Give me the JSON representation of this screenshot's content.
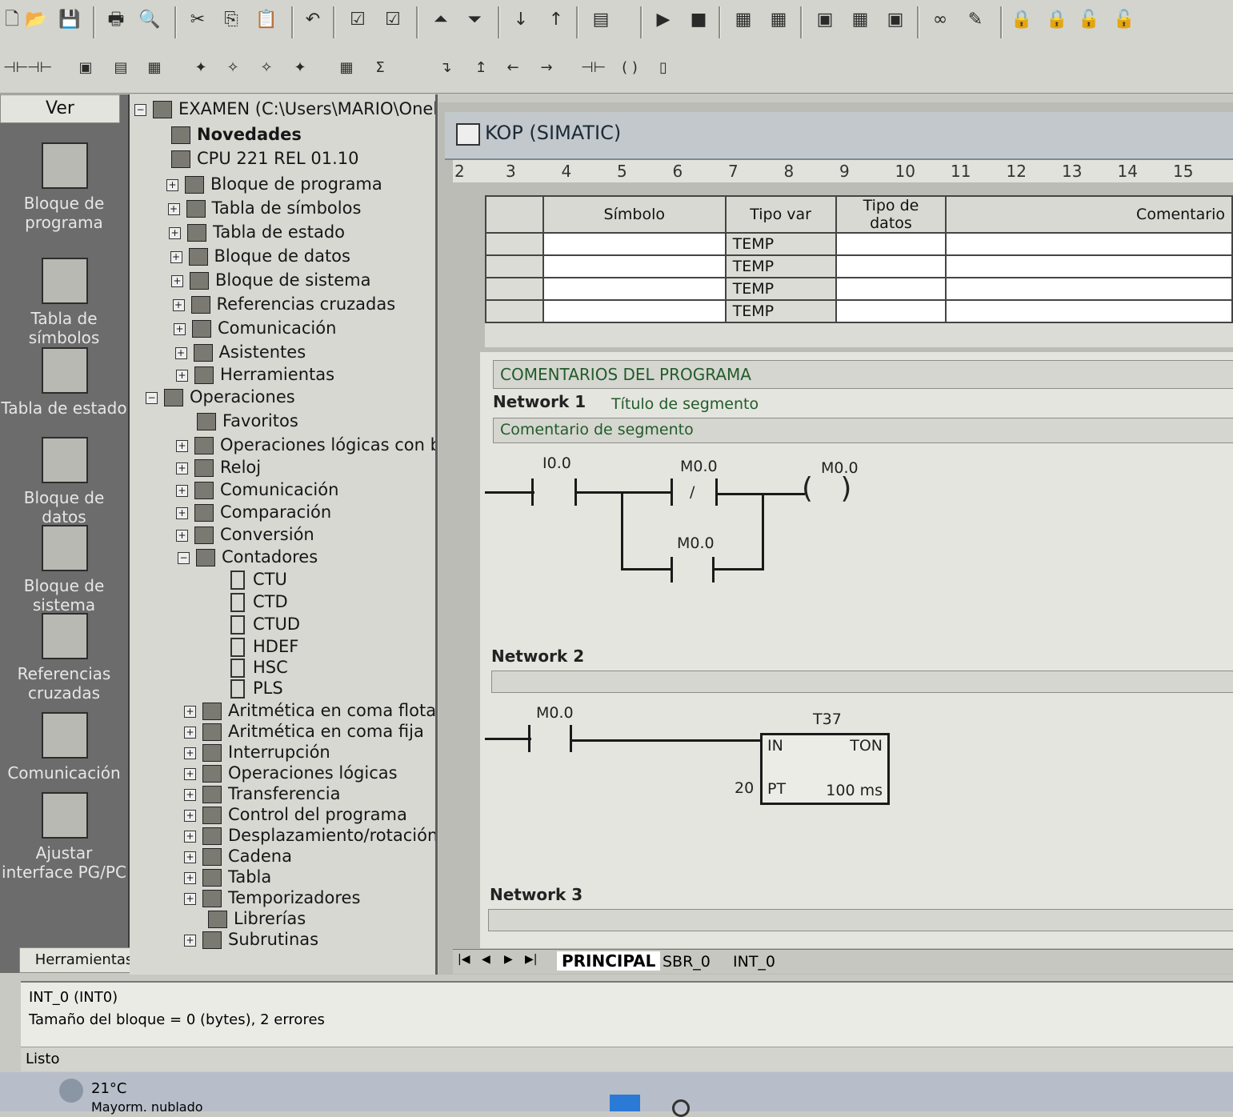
{
  "toolbar": {
    "row1_icons": [
      "new-icon",
      "open-icon",
      "save-icon",
      "print-icon",
      "print-preview-icon",
      "cut-icon",
      "copy-icon",
      "paste-icon",
      "undo-icon",
      "compile-icon",
      "compile-all-icon",
      "upload-icon",
      "download-icon",
      "sort-asc-icon",
      "sort-desc-icon",
      "options-icon",
      "run-icon",
      "stop-icon",
      "program-status-icon",
      "status-table-icon",
      "chart-icon",
      "table-icon",
      "compare-icon",
      "watch-icon",
      "eraser-icon",
      "lock-icon",
      "lock2-icon",
      "unlock-icon",
      "unlock2-icon"
    ],
    "row2_icons": [
      "contact-nav-icon",
      "coil-nav-icon",
      "view-ladder-icon",
      "view-stl-icon",
      "view-fbd-icon",
      "bookmark-icon",
      "bookmark-next-icon",
      "bookmark-prev-icon",
      "bookmark-clear-icon",
      "network-insert-icon",
      "symbol-info-icon",
      "line-down-icon",
      "line-up-icon",
      "line-left-icon",
      "line-right-icon",
      "contact-icon",
      "coil-icon",
      "box-icon"
    ]
  },
  "nav": {
    "header": "Ver",
    "items": [
      {
        "label": "Bloque de programa"
      },
      {
        "label": "Tabla de símbolos"
      },
      {
        "label": "Tabla de estado"
      },
      {
        "label": "Bloque de datos"
      },
      {
        "label": "Bloque de sistema"
      },
      {
        "label": "Referencias cruzadas"
      },
      {
        "label": "Comunicación"
      },
      {
        "label": "Ajustar interface PG/PC"
      }
    ],
    "footer": "Herramientas"
  },
  "tree": {
    "root": "EXAMEN (C:\\Users\\MARIO\\Onel",
    "novedades": "Novedades",
    "cpu": "CPU 221 REL 01.10",
    "items": [
      "Bloque de programa",
      "Tabla de símbolos",
      "Tabla de estado",
      "Bloque de datos",
      "Bloque de sistema",
      "Referencias cruzadas",
      "Comunicación",
      "Asistentes",
      "Herramientas"
    ],
    "operaciones": "Operaciones",
    "ops": [
      "Favoritos",
      "Operaciones lógicas con bits",
      "Reloj",
      "Comunicación",
      "Comparación",
      "Conversión"
    ],
    "contadores": "Contadores",
    "counters": [
      "CTU",
      "CTD",
      "CTUD",
      "HDEF",
      "HSC",
      "PLS"
    ],
    "ops2": [
      "Aritmética en coma flotante",
      "Aritmética en coma fija",
      "Interrupción",
      "Operaciones lógicas",
      "Transferencia",
      "Control del programa",
      "Desplazamiento/rotación",
      "Cadena",
      "Tabla",
      "Temporizadores",
      "Librerías",
      "Subrutinas"
    ]
  },
  "editor": {
    "title": "KOP (SIMATIC)",
    "ruler": [
      "2",
      "3",
      "4",
      "5",
      "6",
      "7",
      "8",
      "9",
      "10",
      "11",
      "12",
      "13",
      "14",
      "15"
    ],
    "var_headers": [
      "Símbolo",
      "Tipo var",
      "Tipo de datos",
      "Comentario"
    ],
    "var_rows": [
      "TEMP",
      "TEMP",
      "TEMP",
      "TEMP"
    ],
    "program_comment": "COMENTARIOS DEL PROGRAMA",
    "network1": {
      "label": "Network 1",
      "title": "Título de segmento",
      "comment": "Comentario de segmento",
      "contact1": "I0.0",
      "contact2": "M0.0",
      "contact2_sym": "/",
      "coil": "M0.0",
      "branch": "M0.0"
    },
    "network2": {
      "label": "Network 2",
      "contact": "M0.0",
      "timer": "T37",
      "timer_type": "TON",
      "in": "IN",
      "pt": "PT",
      "pt_val": "20",
      "base": "100 ms"
    },
    "network3": {
      "label": "Network 3"
    }
  },
  "tabs": [
    "PRINCIPAL",
    "SBR_0",
    "INT_0"
  ],
  "status": {
    "line1": "INT_0 (INT0)",
    "line2": "Tamaño del bloque = 0 (bytes), 2 errores",
    "ready": "Listo"
  },
  "taskbar": {
    "temp": "21°C",
    "weather": "Mayorm. nublado"
  }
}
